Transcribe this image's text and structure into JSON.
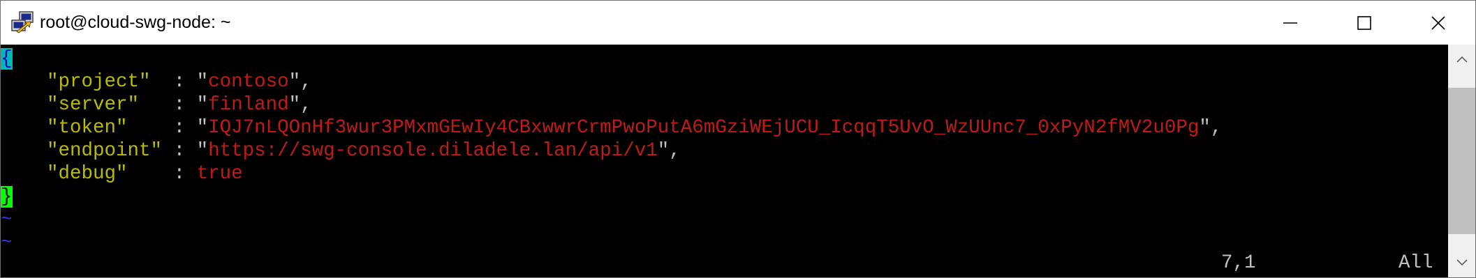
{
  "window": {
    "title": "root@cloud-swg-node: ~",
    "icon": "putty-terminal-icon",
    "controls": [
      "minimize",
      "maximize",
      "close"
    ]
  },
  "editor": {
    "lines": [
      {
        "open_brace": "{"
      },
      {
        "indent": "    ",
        "key": "\"project\"",
        "pad": "  ",
        "sep": ": ",
        "q1": "\"",
        "value": "contoso",
        "q2": "\"",
        "trail": ","
      },
      {
        "indent": "    ",
        "key": "\"server\"",
        "pad": "   ",
        "sep": ": ",
        "q1": "\"",
        "value": "finland",
        "q2": "\"",
        "trail": ","
      },
      {
        "indent": "    ",
        "key": "\"token\"",
        "pad": "    ",
        "sep": ": ",
        "q1": "\"",
        "value": "IQJ7nLQOnHf3wur3PMxmGEwIy4CBxwwrCrmPwoPutA6mGziWEjUCU_IcqqT5UvO_WzUUnc7_0xPyN2fMV2u0Pg",
        "q2": "\"",
        "trail": ","
      },
      {
        "indent": "    ",
        "key": "\"endpoint\"",
        "pad": " ",
        "sep": ": ",
        "q1": "\"",
        "value": "https://swg-console.diladele.lan/api/v1",
        "q2": "\"",
        "trail": ","
      },
      {
        "indent": "    ",
        "key": "\"debug\"",
        "pad": "    ",
        "sep": ": ",
        "q1": "",
        "value": "true",
        "q2": "",
        "trail": ""
      },
      {
        "close_brace": "}"
      },
      {
        "tilde": "~"
      },
      {
        "tilde": "~"
      }
    ],
    "status": {
      "position": "7,1",
      "scroll": "All"
    }
  },
  "colors": {
    "key": "#bbbb00",
    "string_value": "#c11b17",
    "cursor_open": "#00b7b7",
    "cursor_close": "#00ff00",
    "tilde": "#3333ee",
    "background": "#000000"
  }
}
